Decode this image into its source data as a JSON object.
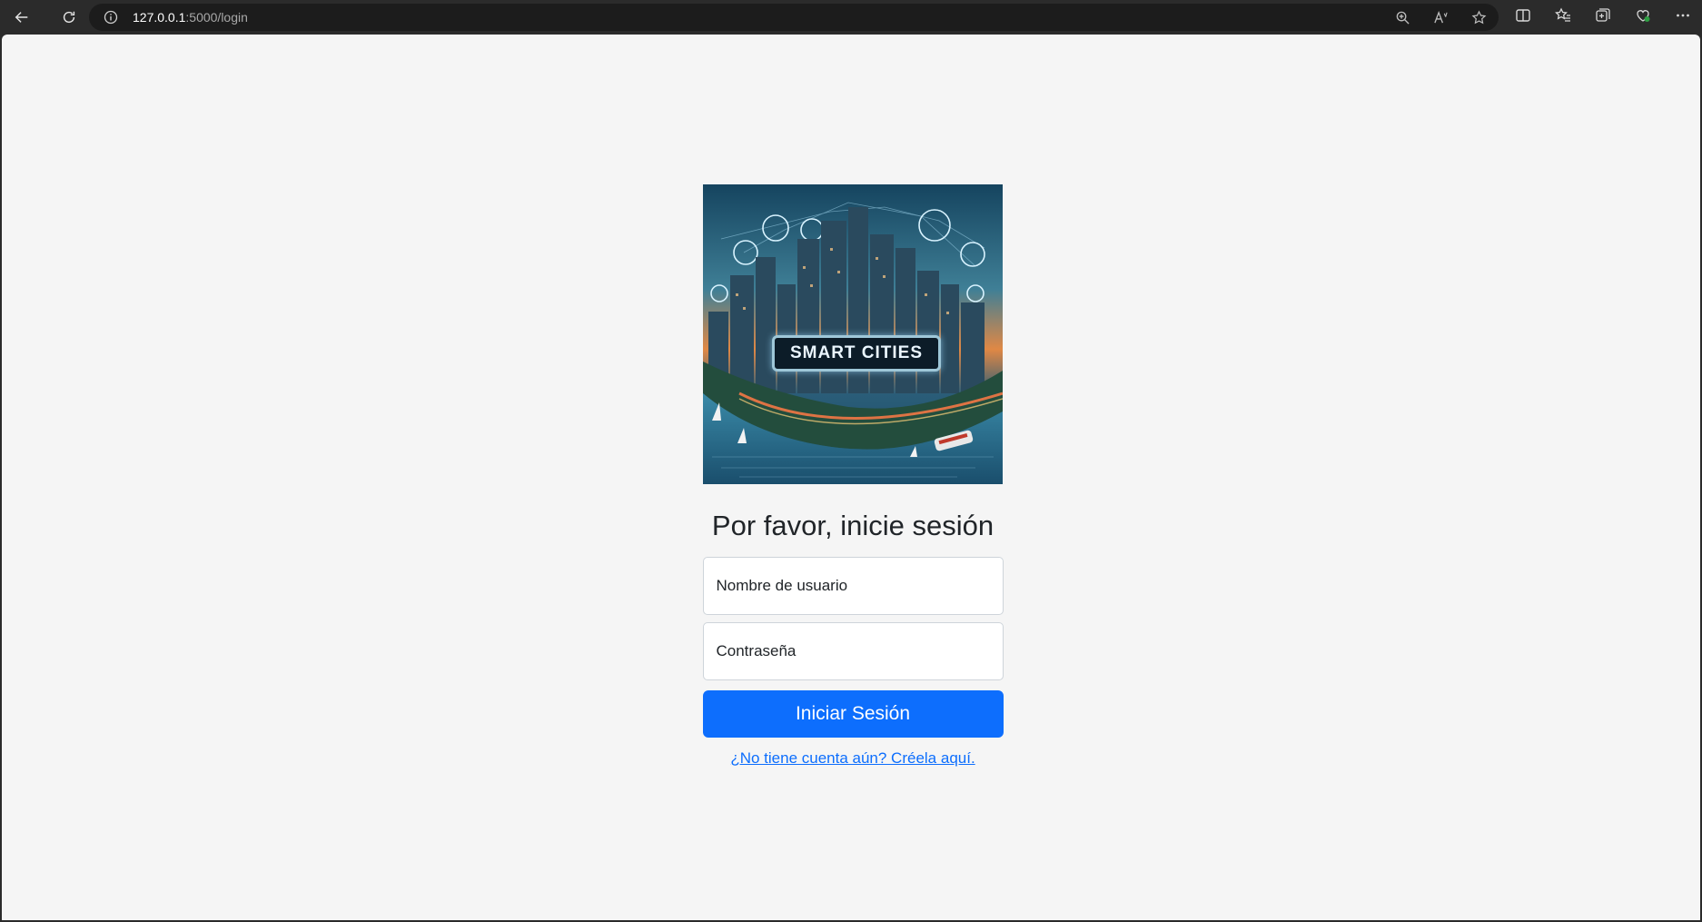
{
  "browser": {
    "url_host": "127.0.0.1",
    "url_path": ":5000/login"
  },
  "hero": {
    "sign_text": "SMART CITIES"
  },
  "login": {
    "heading": "Por favor, inicie sesión",
    "username_placeholder": "Nombre de usuario",
    "password_placeholder": "Contraseña",
    "submit_label": "Iniciar Sesión",
    "signup_link": "¿No tiene cuenta aún? Créela aquí."
  },
  "colors": {
    "primary": "#0d6efd",
    "page_bg": "#f5f5f5",
    "browser_chrome": "#2b2b2b"
  }
}
